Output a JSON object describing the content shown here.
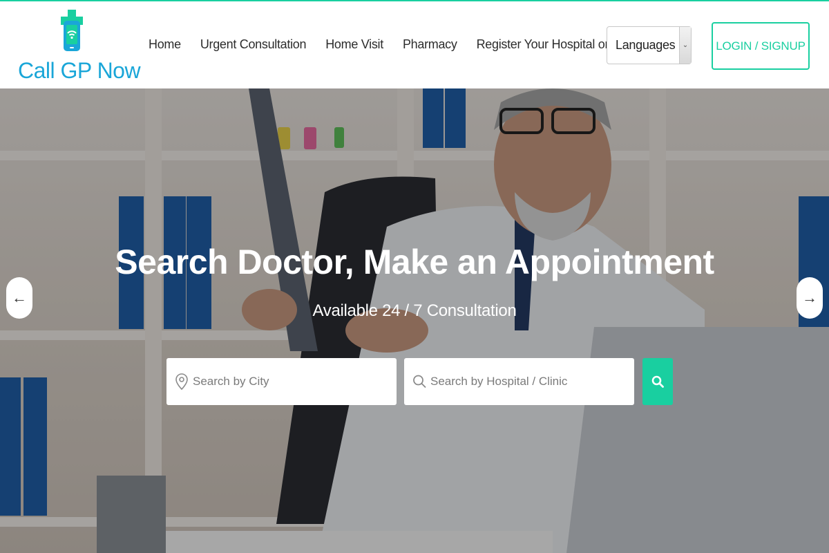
{
  "brand": {
    "name": "Call GP Now",
    "accent_color": "#19cfa0",
    "logo_text_color": "#1aa6d8"
  },
  "nav": {
    "items": [
      {
        "label": "Home"
      },
      {
        "label": "Urgent Consultation"
      },
      {
        "label": "Home Visit"
      },
      {
        "label": "Pharmacy"
      },
      {
        "label": "Register Your Hospital or Clinic"
      }
    ]
  },
  "language_select": {
    "value": "Languages",
    "icon": "chevron-down-icon"
  },
  "login_button": {
    "label": "LOGIN / SIGNUP"
  },
  "hero": {
    "title": "Search Doctor, Make an Appointment",
    "subtitle": "Available 24 / 7 Consultation",
    "city_search": {
      "placeholder": "Search by City",
      "icon": "map-pin-icon"
    },
    "hospital_search": {
      "placeholder": "Search by Hospital / Clinic",
      "icon": "search-icon"
    },
    "search_button": {
      "icon": "search-icon"
    },
    "prev_arrow": "←",
    "next_arrow": "→"
  }
}
